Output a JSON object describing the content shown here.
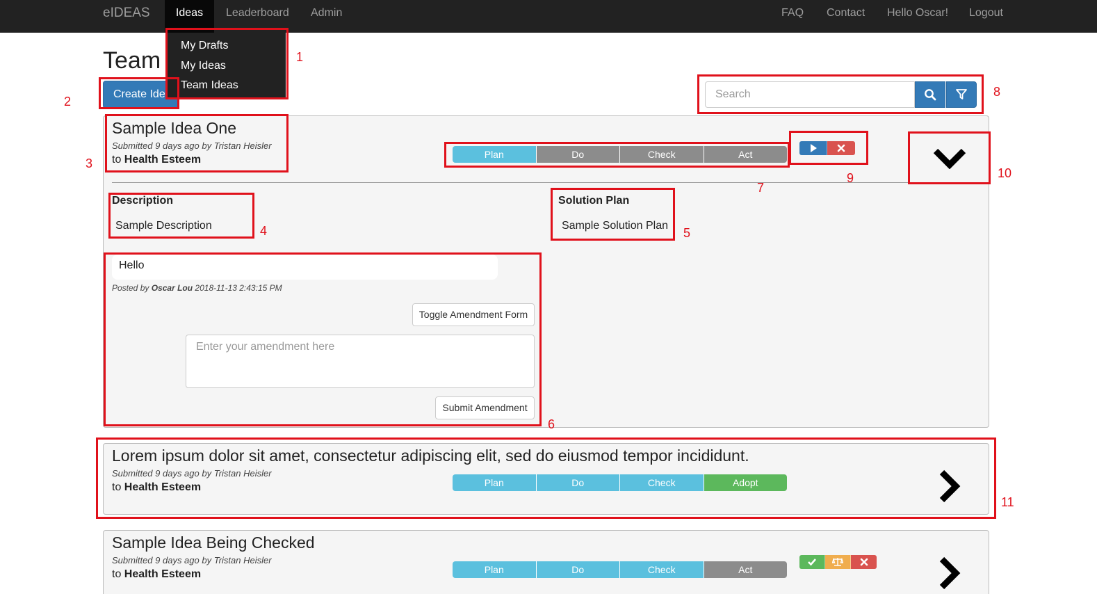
{
  "nav": {
    "brand": "eIDEAS",
    "items": [
      "Ideas",
      "Leaderboard",
      "Admin"
    ],
    "right_items": [
      "FAQ",
      "Contact",
      "Hello Oscar!",
      "Logout"
    ]
  },
  "dropdown": {
    "items": [
      "My Drafts",
      "My Ideas",
      "Team Ideas"
    ]
  },
  "page": {
    "title": "Team",
    "create_button": "Create Ide"
  },
  "search": {
    "placeholder": "Search",
    "search_icon": "search-icon",
    "filter_icon": "filter-icon"
  },
  "colors": {
    "nav_bg": "#222222",
    "primary": "#337ab7",
    "info": "#5bc0de",
    "grey": "#8c8c8c",
    "success": "#5cb85c",
    "warning": "#f0ad4e",
    "danger": "#d9534f",
    "annotation": "#e0111b"
  },
  "ideas": [
    {
      "title": "Sample Idea One",
      "submitted": "Submitted 9 days ago by Tristan Heisler",
      "to_prefix": "to",
      "team": "Health Esteem",
      "stages": [
        "Plan",
        "Do",
        "Check",
        "Act"
      ],
      "stage_colors": [
        "#5bc0de",
        "#8c8c8c",
        "#8c8c8c",
        "#8c8c8c"
      ],
      "actions": [
        "play-icon",
        "close-icon"
      ],
      "expand_icon": "chevron-down-icon",
      "description_label": "Description",
      "description": "Sample Description",
      "solution_label": "Solution Plan",
      "solution": "Sample Solution Plan",
      "comment": {
        "text": "Hello",
        "posted_prefix": "Posted by",
        "author": "Oscar Lou",
        "timestamp": "2018-11-13 2:43:15 PM"
      },
      "toggle_button": "Toggle Amendment Form",
      "amendment_placeholder": "Enter your amendment here",
      "submit_button": "Submit Amendment"
    },
    {
      "title": "Lorem ipsum dolor sit amet, consectetur adipiscing elit, sed do eiusmod tempor incididunt.",
      "submitted": "Submitted 9 days ago by Tristan Heisler",
      "to_prefix": "to",
      "team": "Health Esteem",
      "stages": [
        "Plan",
        "Do",
        "Check",
        "Adopt"
      ],
      "stage_colors": [
        "#5bc0de",
        "#5bc0de",
        "#5bc0de",
        "#5cb85c"
      ],
      "expand_icon": "chevron-right-icon"
    },
    {
      "title": "Sample Idea Being Checked",
      "submitted": "Submitted 9 days ago by Tristan Heisler",
      "to_prefix": "to",
      "team": "Health Esteem",
      "stages": [
        "Plan",
        "Do",
        "Check",
        "Act"
      ],
      "stage_colors": [
        "#5bc0de",
        "#5bc0de",
        "#5bc0de",
        "#8c8c8c"
      ],
      "actions": [
        "check-icon",
        "balance-scale-icon",
        "close-icon"
      ],
      "expand_icon": "chevron-right-icon"
    }
  ],
  "annotations": [
    "1",
    "2",
    "3",
    "4",
    "5",
    "6",
    "7",
    "8",
    "9",
    "10",
    "11"
  ]
}
